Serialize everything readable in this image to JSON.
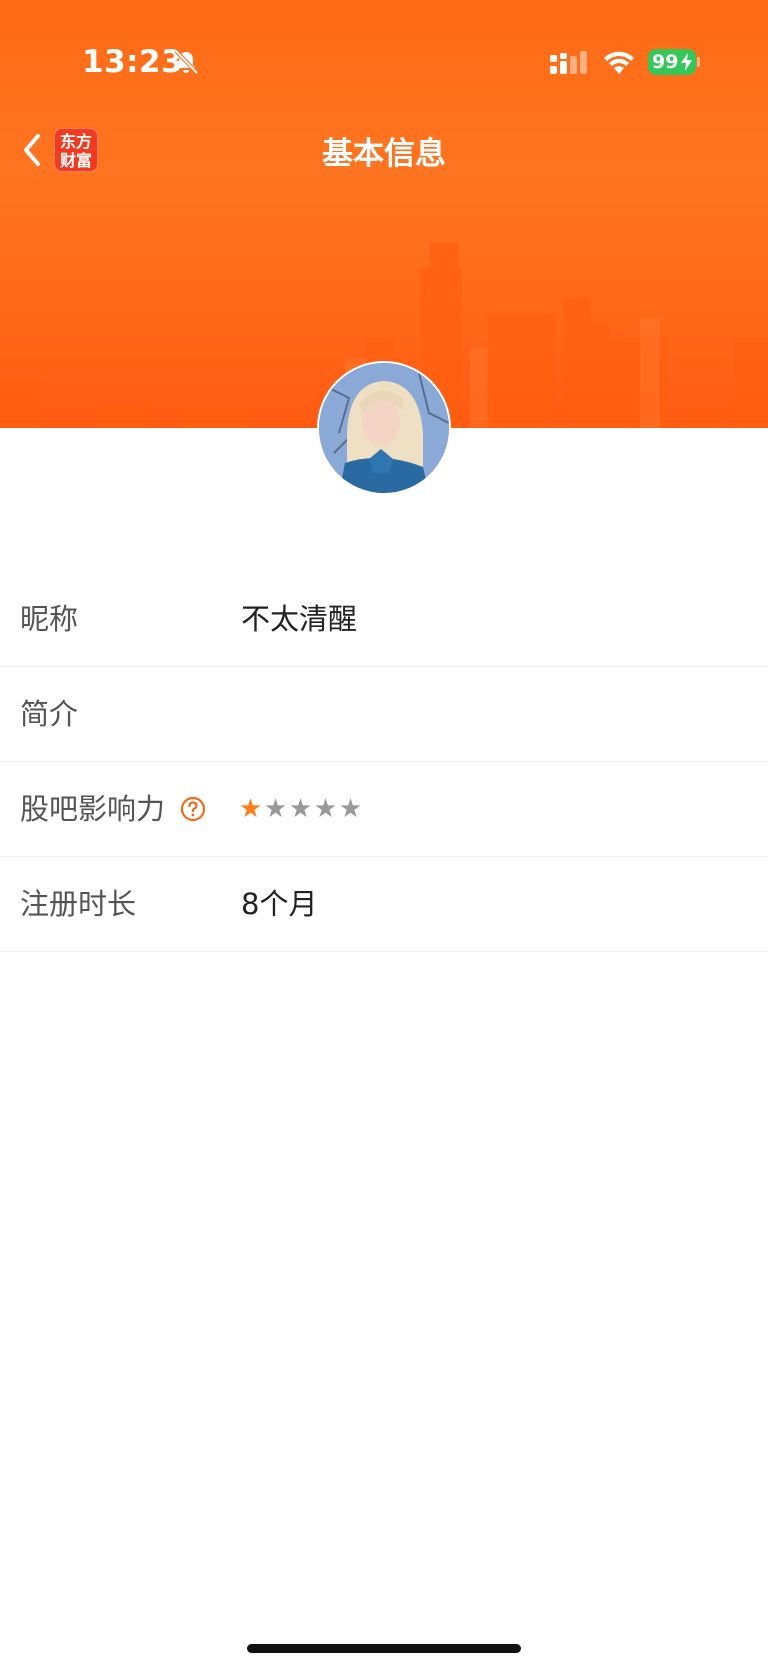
{
  "status_bar": {
    "time": "13:23",
    "battery": "99"
  },
  "nav": {
    "title": "基本信息",
    "logo_line1": "东方",
    "logo_line2": "财富"
  },
  "rows": [
    {
      "label": "昵称",
      "value": "不太清醒"
    },
    {
      "label": "简介",
      "value": ""
    },
    {
      "label": "股吧影响力",
      "value": ""
    },
    {
      "label": "注册时长",
      "value": "8个月"
    }
  ],
  "influence": {
    "rating": 1,
    "max": 5
  },
  "colors": {
    "brand": "#ff6a14",
    "star_active": "#ff7e1a",
    "star_inactive": "#999999",
    "battery": "#34c759"
  },
  "icons": {
    "back": "chevron-left-icon",
    "mute": "bell-slash-icon",
    "help": "question-circle-icon"
  }
}
